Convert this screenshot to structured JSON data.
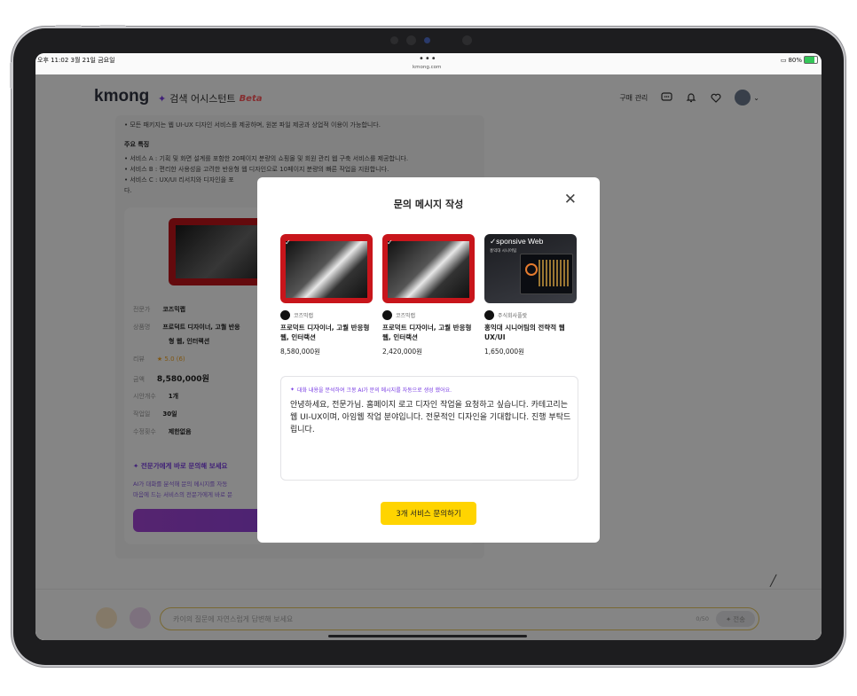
{
  "status_bar": {
    "time": "오후 11:02  3월 21일 금요일",
    "dots": "•••",
    "url": "kmong.com",
    "battery": "80%"
  },
  "header": {
    "logo": "kmong",
    "assistant_label": "검색 어시스턴트",
    "beta_label": "Beta",
    "purchase_label": "구매 관리"
  },
  "background": {
    "bullet_top": "• 모든 패키지는 웹 UI-UX 디자인 서비스를 제공하며, 원본 파일 제공과 상업적 이용이 가능합니다.",
    "features_title": "주요 특징",
    "features": [
      "• 서비스 A : 기획 및 화면 설계를 포함한 20페이지 분량의 쇼핑몰 및 회원 관리 웹 구축 서비스를 제공합니다.",
      "• 서비스 B : 편리한 사용성을 고려한 반응형 웹 디자인으로 10페이지 분량의 빠른 작업을 지원합니다.",
      "• 서비스 C : UX/UI 리서치와 디자인을 포",
      "다."
    ],
    "detail": {
      "expert_label": "전문가",
      "expert_value": "코즈믹랩",
      "product_label": "상품명",
      "product_value": "프로덕트 디자이너, 고퀄 반응",
      "product_value2": "형 웹, 인터랙션",
      "review_label": "리뷰",
      "review_value": "★ 5.0 (6)",
      "price_label": "금액",
      "price_value": "8,580,000원",
      "draft_label": "시안개수",
      "draft_value": "1개",
      "days_label": "작업일",
      "days_value": "30일",
      "rev_label": "수정횟수",
      "rev_value": "제한없음"
    },
    "ask_title": "✦ 전문가에게 바로 문의해 보세요",
    "ask_line1": "AI가 대화를 분석해 문의 메시지를 자동",
    "ask_line2": "마음에 드는 서비스의 전문가에게 바로 문"
  },
  "chat_bar": {
    "placeholder": "카이의 질문에 자연스럽게 답변해 보세요",
    "count": "0/50",
    "send_label": "전송"
  },
  "modal": {
    "title": "문의 메시지 작성",
    "services": [
      {
        "seller": "코즈믹랩",
        "name": "프로덕트 디자이너, 고퀄 반응형 웹, 인터랙션",
        "price": "8,580,000원"
      },
      {
        "seller": "코즈믹랩",
        "name": "프로덕트 디자이너, 고퀄 반응형 웹, 인터랙션",
        "price": "2,420,000원"
      },
      {
        "seller": "주식회사플랏",
        "name": "홍익대 시니어팀의 전략적 웹 UX/UI",
        "price": "1,650,000원",
        "thumb_title": "sponsive Web",
        "thumb_sub": "홍익대 시니어팀"
      }
    ],
    "ai_note": "대화 내용을 분석하여 크몽 AI가 문의 메시지를 자동으로 생성 했어요.",
    "message": "안녕하세요, 전문가님. 홈페이지 로고 디자인 작업을 요청하고 싶습니다. 카테고리는 웹 UI-UX이며, 아임웹 작업 분야입니다. 전문적인 디자인을 기대합니다. 진행 부탁드립니다.",
    "cta": "3개 서비스 문의하기"
  },
  "colors": {
    "accent_yellow": "#ffd400",
    "purple": "#7b3fe4",
    "red_thumb": "#c8151b"
  }
}
